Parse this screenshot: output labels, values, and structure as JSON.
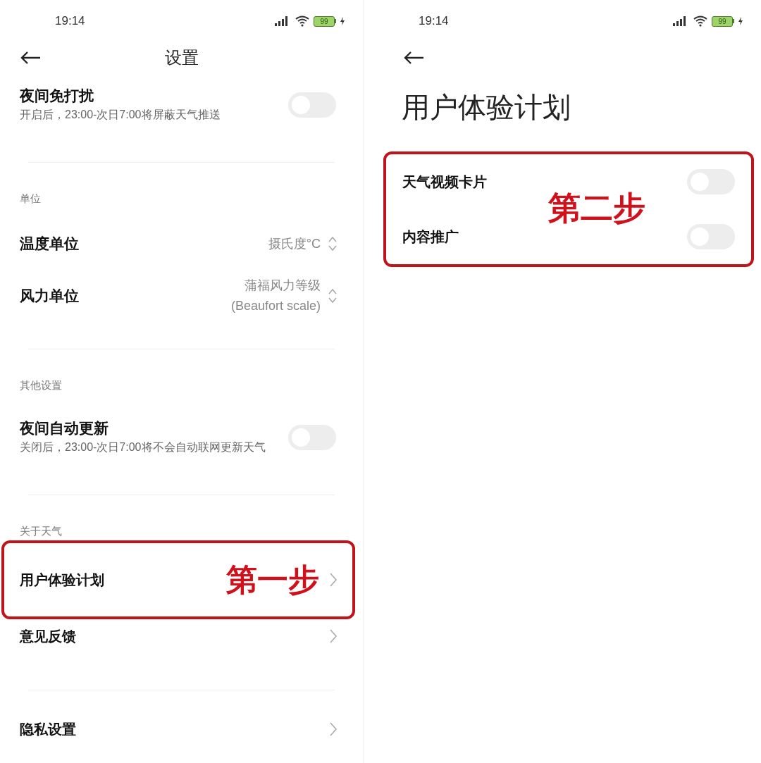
{
  "left_screen": {
    "status_bar": {
      "time": "19:14",
      "battery": "99"
    },
    "title": "设置",
    "sections": [
      {
        "rows": [
          {
            "kind": "toggle",
            "title": "夜间免打扰",
            "subtitle": "开启后，23:00-次日7:00将屏蔽天气推送",
            "on": false
          }
        ]
      },
      {
        "label": "单位",
        "rows": [
          {
            "kind": "select",
            "title": "温度单位",
            "value": [
              "摄氏度°C"
            ]
          },
          {
            "kind": "select",
            "title": "风力单位",
            "value": [
              "蒲福风力等级",
              "(Beaufort scale)"
            ]
          }
        ]
      },
      {
        "label": "其他设置",
        "rows": [
          {
            "kind": "toggle",
            "title": "夜间自动更新",
            "subtitle": "关闭后，23:00-次日7:00将不会自动联网更新天气",
            "on": false
          }
        ]
      },
      {
        "label": "关于天气",
        "rows": [
          {
            "kind": "link",
            "title": "用户体验计划",
            "annotation": "第一步"
          },
          {
            "kind": "link",
            "title": "意见反馈"
          }
        ]
      },
      {
        "rows": [
          {
            "kind": "link",
            "title": "隐私设置"
          }
        ]
      }
    ]
  },
  "right_screen": {
    "status_bar": {
      "time": "19:14",
      "battery": "99"
    },
    "title": "用户体验计划",
    "annotation": "第二步",
    "rows": [
      {
        "title": "天气视频卡片",
        "on": false
      },
      {
        "title": "内容推广",
        "on": false
      }
    ]
  }
}
